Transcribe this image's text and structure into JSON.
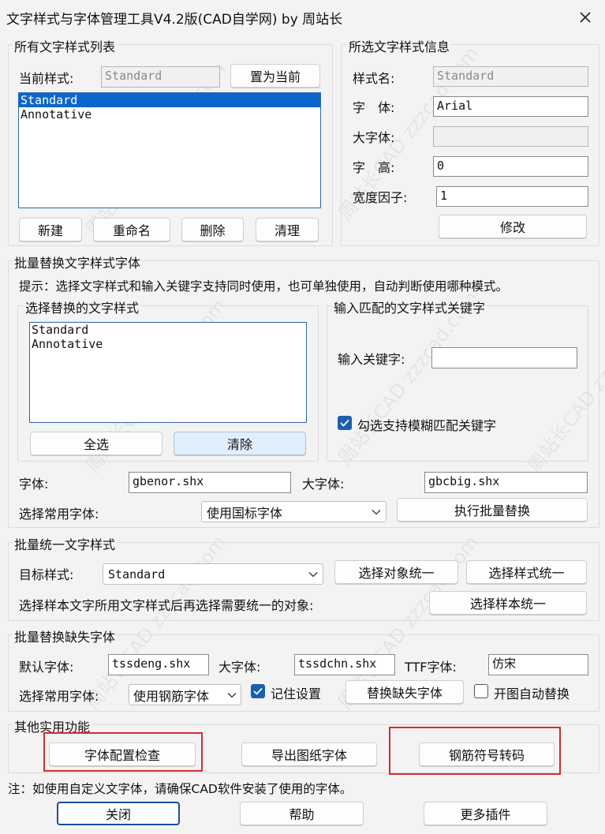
{
  "window": {
    "title": "文字样式与字体管理工具V4.2版(CAD自学网) by 周站长"
  },
  "style_list": {
    "group_label": "所有文字样式列表",
    "current_label": "当前样式:",
    "current_value": "Standard",
    "set_current_button": "置为当前",
    "items": [
      "Standard",
      "Annotative"
    ],
    "selected_index": 0,
    "buttons": {
      "new": "新建",
      "rename": "重命名",
      "delete": "删除",
      "purge": "清理"
    }
  },
  "style_info": {
    "group_label": "所选文字样式信息",
    "name_label": "样式名:",
    "name_value": "Standard",
    "font_label": "字　体:",
    "font_value": "Arial",
    "bigfont_label": "大字体:",
    "bigfont_value": "",
    "height_label": "字　高:",
    "height_value": "0",
    "width_label": "宽度因子:",
    "width_value": "1",
    "modify_button": "修改"
  },
  "batch_replace": {
    "group_label": "批量替换文字样式字体",
    "hint": "提示：选择文字样式和输入关键字支持同时使用，也可单独使用，自动判断使用哪种模式。",
    "select_group_label": "选择替换的文字样式",
    "items": [
      "Standard",
      "Annotative"
    ],
    "select_all_button": "全选",
    "clear_button": "清除",
    "keyword_group_label": "输入匹配的文字样式关键字",
    "keyword_label": "输入关键字:",
    "keyword_value": "",
    "fuzzy_label": "勾选支持模糊匹配关键字",
    "fuzzy_checked": true,
    "font_label": "字体:",
    "font_value": "gbenor.shx",
    "bigfont_label": "大字体:",
    "bigfont_value": "gbcbig.shx",
    "common_font_label": "选择常用字体:",
    "common_font_value": "使用国标字体",
    "execute_button": "执行批量替换"
  },
  "unify": {
    "group_label": "批量统一文字样式",
    "target_label": "目标样式:",
    "target_value": "Standard",
    "select_object_button": "选择对象统一",
    "select_style_button": "选择样式统一",
    "sample_hint": "选择样本文字所用文字样式后再选择需要统一的对象:",
    "sample_button": "选择样本统一"
  },
  "missing": {
    "group_label": "批量替换缺失字体",
    "default_font_label": "默认字体:",
    "default_font_value": "tssdeng.shx",
    "bigfont_label": "大字体:",
    "bigfont_value": "tssdchn.shx",
    "ttf_label": "TTF字体:",
    "ttf_value": "仿宋",
    "common_font_label": "选择常用字体:",
    "common_font_value": "使用钢筋字体",
    "remember_label": "记住设置",
    "remember_checked": true,
    "replace_button": "替换缺失字体",
    "auto_label": "开图自动替换",
    "auto_checked": false
  },
  "other": {
    "group_label": "其他实用功能",
    "check_button": "字体配置检查",
    "export_button": "导出图纸字体",
    "rebar_button": "钢筋符号转码"
  },
  "footer": {
    "note": "注：如使用自定义文字体，请确保CAD软件安装了使用的字体。",
    "close_button": "关闭",
    "help_button": "帮助",
    "more_button": "更多插件"
  },
  "watermark": {
    "text": "周站长CAD zzzcad.com"
  }
}
